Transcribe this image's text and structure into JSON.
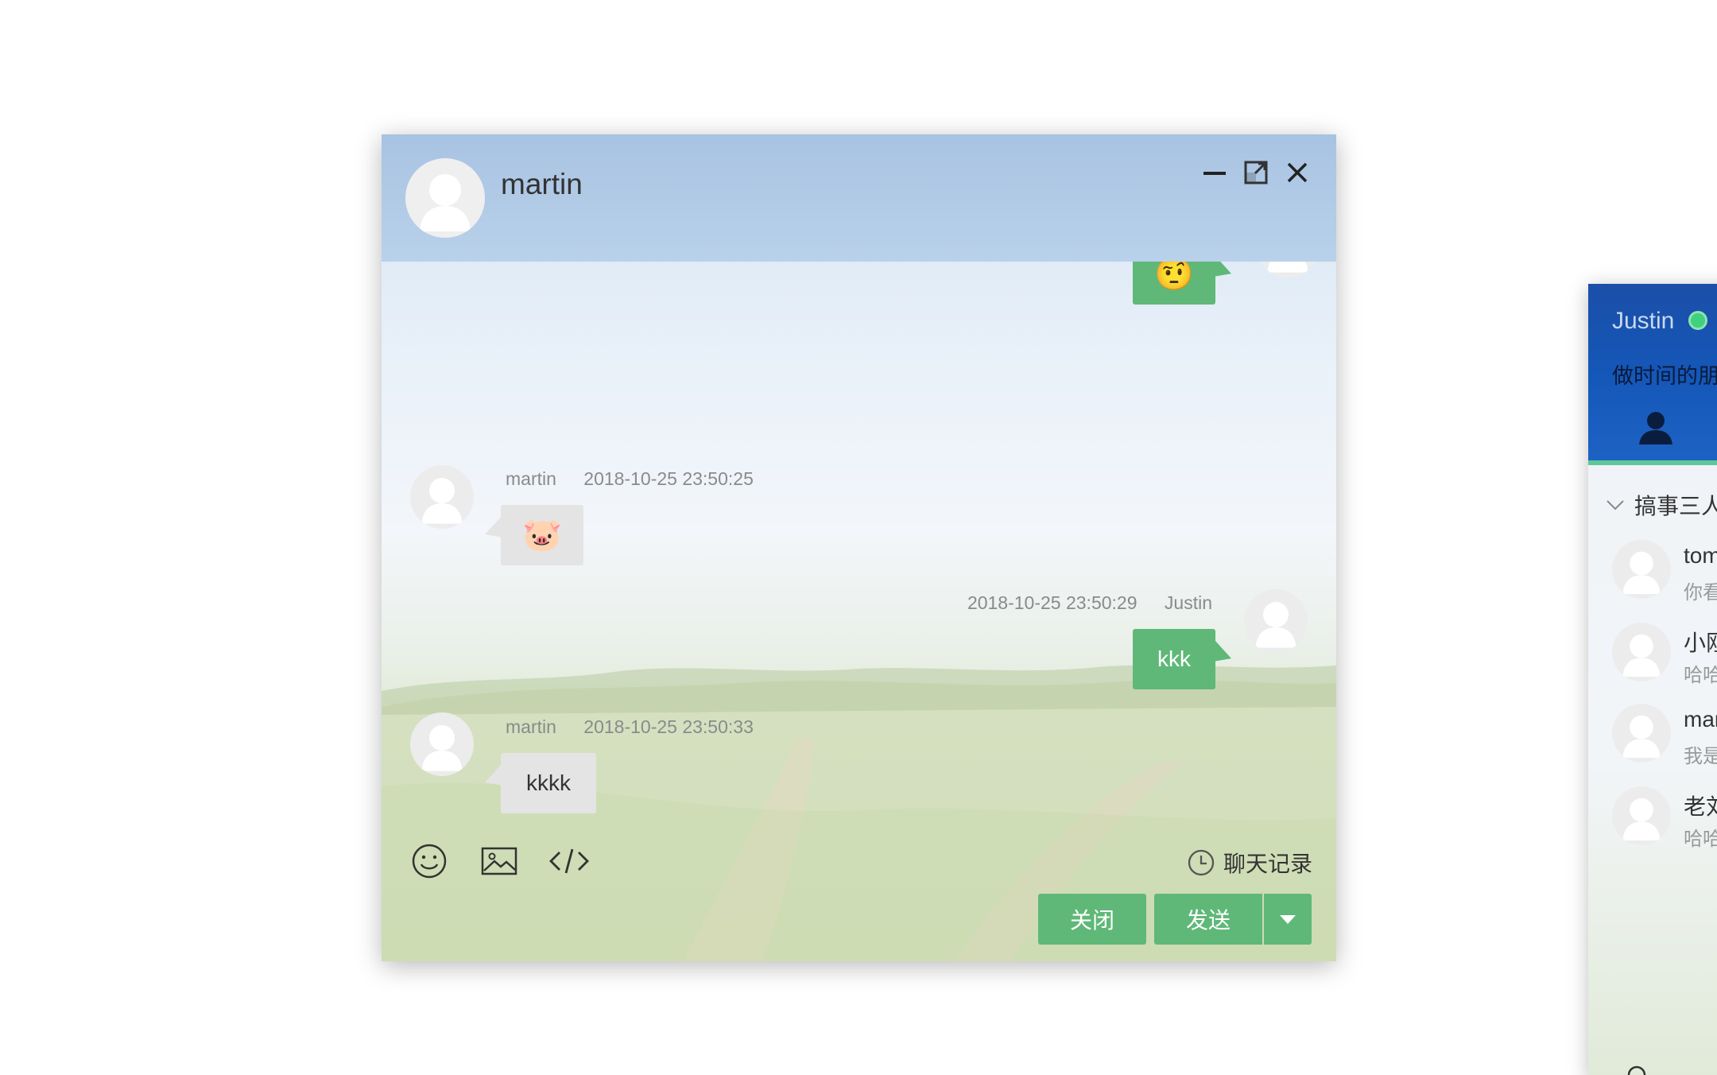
{
  "chat": {
    "contact_name": "martin",
    "window_controls": {
      "minimize": "minimize-icon",
      "maximize": "maximize-icon",
      "close": "close-icon"
    },
    "messages": [
      {
        "direction": "out",
        "type": "emoji",
        "content": "🤨"
      },
      {
        "direction": "in",
        "sender": "martin",
        "time": "2018-10-25 23:50:25",
        "type": "emoji",
        "content": "🐷"
      },
      {
        "direction": "out",
        "sender": "Justin",
        "time": "2018-10-25 23:50:29",
        "type": "text",
        "content": "kkk"
      },
      {
        "direction": "in",
        "sender": "martin",
        "time": "2018-10-25 23:50:33",
        "type": "text",
        "content": "kkkk"
      }
    ],
    "toolbar": {
      "tools": [
        "smile-icon",
        "image-icon",
        "code-icon"
      ],
      "history_label": "聊天记录"
    },
    "buttons": {
      "close_label": "关闭",
      "send_label": "发送"
    }
  },
  "side_panel": {
    "user_name": "Justin",
    "status_color": "#3fd17e",
    "signature": "做时间的朋",
    "group_name": "搞事三人",
    "friends": [
      {
        "name": "tom",
        "sign": "你看"
      },
      {
        "name": "小刚",
        "sign": "哈哈"
      },
      {
        "name": "mar",
        "sign": "我是"
      },
      {
        "name": "老刘",
        "sign": "哈哈"
      }
    ]
  },
  "colors": {
    "accent": "#5fb878",
    "header": "#a8c3e2",
    "side_header": "#1b4fa8"
  }
}
